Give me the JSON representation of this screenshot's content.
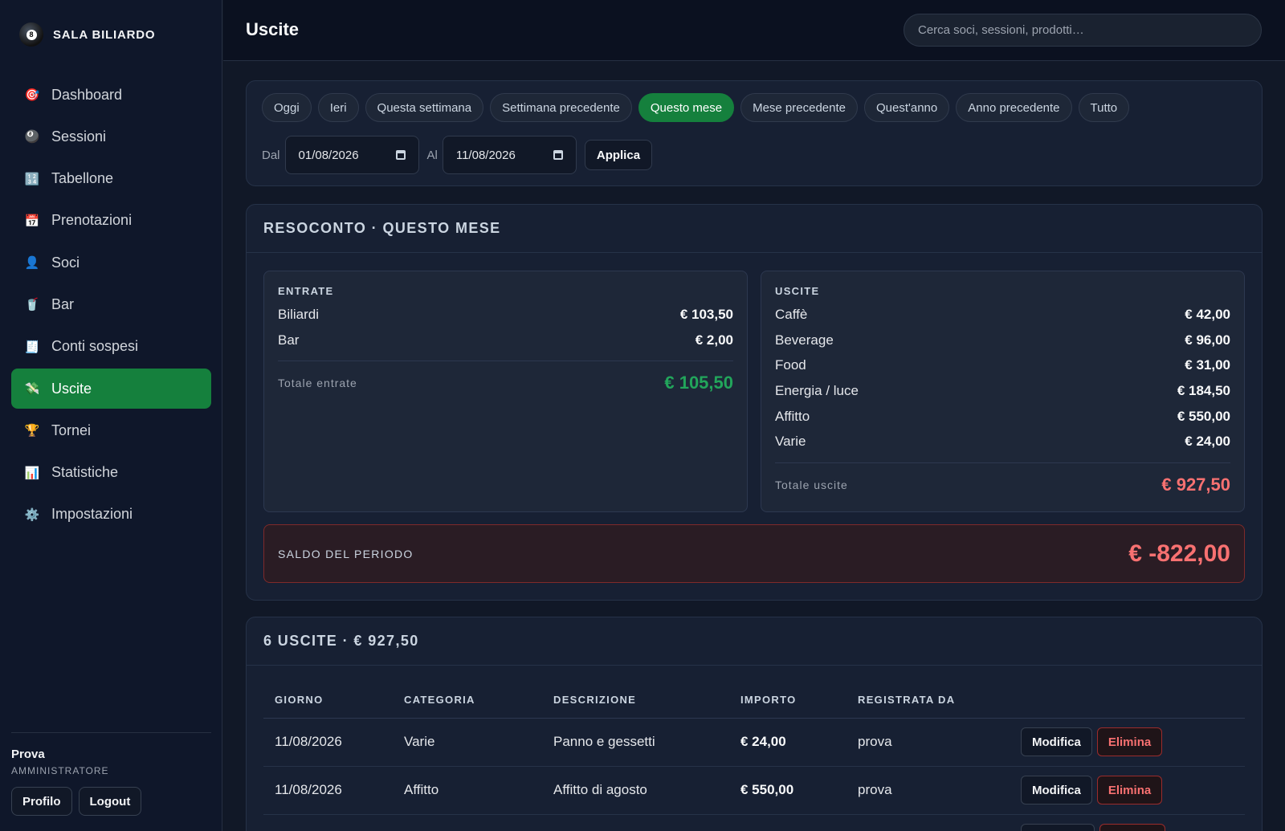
{
  "app": {
    "brand": "SALA BILIARDO"
  },
  "sidebar": {
    "items": [
      {
        "label": "Dashboard",
        "icon": "🎯"
      },
      {
        "label": "Sessioni",
        "icon": "🎱"
      },
      {
        "label": "Tabellone",
        "icon": "🔢"
      },
      {
        "label": "Prenotazioni",
        "icon": "📅"
      },
      {
        "label": "Soci",
        "icon": "👤"
      },
      {
        "label": "Bar",
        "icon": "🥤"
      },
      {
        "label": "Conti sospesi",
        "icon": "🧾"
      },
      {
        "label": "Uscite",
        "icon": "💸"
      },
      {
        "label": "Tornei",
        "icon": "🏆"
      },
      {
        "label": "Statistiche",
        "icon": "📊"
      },
      {
        "label": "Impostazioni",
        "icon": "⚙️"
      }
    ],
    "active": "Uscite",
    "user": {
      "name": "Prova",
      "role": "AMMINISTRATORE",
      "profile_label": "Profilo",
      "logout_label": "Logout"
    }
  },
  "header": {
    "title": "Uscite",
    "search_placeholder": "Cerca soci, sessioni, prodotti…"
  },
  "filters": {
    "chips": [
      "Oggi",
      "Ieri",
      "Questa settimana",
      "Settimana precedente",
      "Questo mese",
      "Mese precedente",
      "Quest'anno",
      "Anno precedente",
      "Tutto"
    ],
    "active_chip": "Questo mese",
    "from_label": "Dal",
    "from_value": "01/08/2026",
    "to_label": "Al",
    "to_value": "11/08/2026",
    "apply_label": "Applica"
  },
  "summary": {
    "title": "RESOCONTO · QUESTO MESE",
    "income": {
      "title": "ENTRATE",
      "rows": [
        {
          "label": "Biliardi",
          "value": "€ 103,50"
        },
        {
          "label": "Bar",
          "value": "€ 2,00"
        }
      ],
      "total_label": "Totale entrate",
      "total_value": "€ 105,50"
    },
    "outcome": {
      "title": "USCITE",
      "rows": [
        {
          "label": "Caffè",
          "value": "€ 42,00"
        },
        {
          "label": "Beverage",
          "value": "€ 96,00"
        },
        {
          "label": "Food",
          "value": "€ 31,00"
        },
        {
          "label": "Energia / luce",
          "value": "€ 184,50"
        },
        {
          "label": "Affitto",
          "value": "€ 550,00"
        },
        {
          "label": "Varie",
          "value": "€ 24,00"
        }
      ],
      "total_label": "Totale uscite",
      "total_value": "€ 927,50"
    },
    "balance_label": "SALDO DEL PERIODO",
    "balance_value": "€ -822,00"
  },
  "expenses": {
    "title": "6 USCITE · € 927,50",
    "columns": [
      "GIORNO",
      "CATEGORIA",
      "DESCRIZIONE",
      "IMPORTO",
      "REGISTRATA DA"
    ],
    "rows": [
      {
        "day": "11/08/2026",
        "category": "Varie",
        "description": "Panno e gessetti",
        "amount": "€ 24,00",
        "by": "prova"
      },
      {
        "day": "11/08/2026",
        "category": "Affitto",
        "description": "Affitto di agosto",
        "amount": "€ 550,00",
        "by": "prova"
      }
    ],
    "edit_label": "Modifica",
    "delete_label": "Elimina"
  },
  "colors": {
    "accent": "#15803d",
    "positive": "#22a55b",
    "negative": "#f87171"
  }
}
